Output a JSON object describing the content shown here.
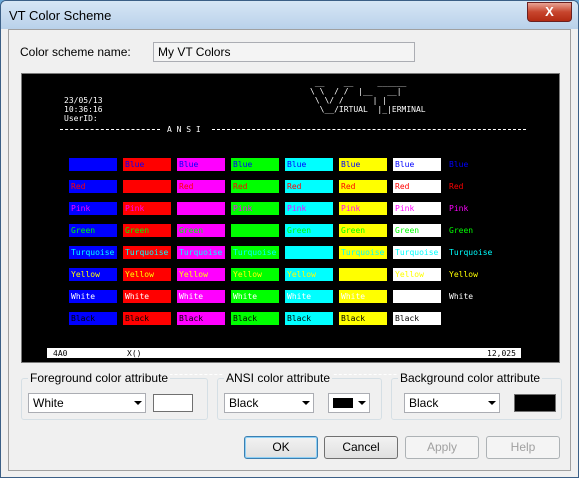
{
  "window": {
    "title": "VT Color Scheme",
    "close_label": "X"
  },
  "scheme": {
    "label": "Color scheme name:",
    "value": "My VT Colors"
  },
  "terminal": {
    "date": "23/05/13",
    "time": "10:36:16",
    "user": "UserID:",
    "logo": [
      " __    __     ______",
      "\\ \\  / /  |__   __|",
      " \\ \\/ /      | |",
      "  \\__/IRTUAL  |_|ERMINAL"
    ],
    "ansi_label": "A N S I",
    "status_left": "4A0",
    "status_mid": "X()",
    "status_right": "12,025",
    "colors": {
      "blue": "#0000ff",
      "red": "#ff0000",
      "pink": "#ff00ff",
      "green": "#00ff00",
      "turquoise": "#00ffff",
      "yellow": "#ffff00",
      "white": "#ffffff",
      "black": "#000000"
    },
    "columns_bg": [
      "blue",
      "red",
      "pink",
      "green",
      "turquoise",
      "yellow",
      "white",
      "black"
    ],
    "rows": [
      {
        "fg": "blue",
        "labels": [
          "",
          "Blue",
          "Blue",
          "Blue",
          "Blue",
          "Blue",
          "Blue",
          "Blue"
        ]
      },
      {
        "fg": "red",
        "labels": [
          "Red",
          "",
          "Red",
          "Red",
          "Red",
          "Red",
          "Red",
          "Red"
        ]
      },
      {
        "fg": "pink",
        "labels": [
          "Pink",
          "Pink",
          "",
          "Pink",
          "Pink",
          "Pink",
          "Pink",
          "Pink"
        ]
      },
      {
        "fg": "green",
        "labels": [
          "Green",
          "Green",
          "Green",
          "",
          "Green",
          "Green",
          "Green",
          "Green"
        ]
      },
      {
        "fg": "turquoise",
        "labels": [
          "Turquoise",
          "Turquoise",
          "Turquoise",
          "Turquoise",
          "",
          "Turquoise",
          "Turquoise",
          "Turquoise"
        ]
      },
      {
        "fg": "yellow",
        "labels": [
          "Yellow",
          "Yellow",
          "Yellow",
          "Yellow",
          "Yellow",
          "",
          "Yellow",
          "Yellow"
        ]
      },
      {
        "fg": "white",
        "labels": [
          "White",
          "White",
          "White",
          "White",
          "White",
          "White",
          "",
          "White"
        ]
      },
      {
        "fg": "black",
        "labels": [
          "Black",
          "Black",
          "Black",
          "Black",
          "Black",
          "Black",
          "Black",
          ""
        ]
      }
    ]
  },
  "foreground": {
    "label": "Foreground color attribute",
    "value": "White",
    "swatch": "#ffffff"
  },
  "ansi": {
    "label": "ANSI color attribute",
    "value": "Black",
    "swatch": "#000000"
  },
  "background": {
    "label": "Background color attribute",
    "value": "Black",
    "swatch": "#000000"
  },
  "buttons": {
    "ok": "OK",
    "cancel": "Cancel",
    "apply": "Apply",
    "help": "Help"
  }
}
